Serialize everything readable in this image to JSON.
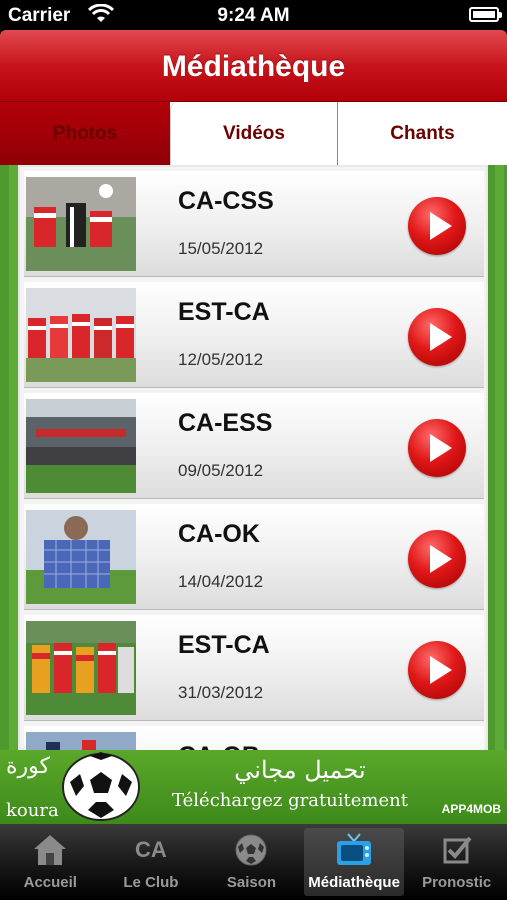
{
  "status_bar": {
    "carrier": "Carrier",
    "time": "9:24 AM"
  },
  "nav": {
    "title": "Médiathèque"
  },
  "tabs": [
    {
      "label": "Photos"
    },
    {
      "label": "Vidéos"
    },
    {
      "label": "Chants"
    }
  ],
  "videos": [
    {
      "match": "CA-CSS",
      "date": "15/05/2012"
    },
    {
      "match": "EST-CA",
      "date": "12/05/2012"
    },
    {
      "match": "CA-ESS",
      "date": "09/05/2012"
    },
    {
      "match": "CA-OK",
      "date": "14/04/2012"
    },
    {
      "match": "EST-CA",
      "date": "31/03/2012"
    },
    {
      "match": "CA-OB",
      "date": ""
    }
  ],
  "ad": {
    "koura_ar": "كورة",
    "koura": "koura",
    "arabic": "تحميل مجاني",
    "french": "Téléchargez gratuitement",
    "brand": "APP4MOB"
  },
  "tab_bar": {
    "items": [
      {
        "label": "Accueil",
        "icon": "home-icon"
      },
      {
        "label": "Le Club",
        "icon": "club-icon",
        "glyph": "CA"
      },
      {
        "label": "Saison",
        "icon": "soccer-ball-icon"
      },
      {
        "label": "Médiathèque",
        "icon": "tv-icon",
        "active": true
      },
      {
        "label": "Pronostic",
        "icon": "checkbox-icon"
      }
    ]
  },
  "colors": {
    "accent_red": "#c8141b",
    "grass": "#4f9a2e",
    "tab_text": "#6a0000"
  }
}
